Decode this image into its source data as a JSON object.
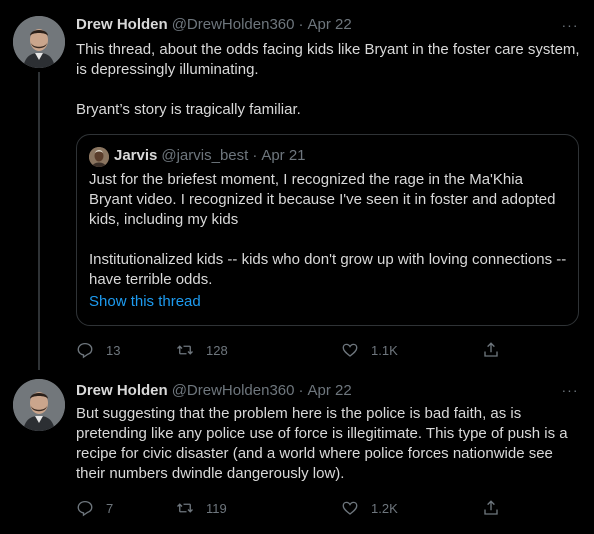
{
  "tweets": [
    {
      "author": {
        "display_name": "Drew Holden",
        "handle": "@DrewHolden360",
        "date": "Apr 22"
      },
      "more_label": "···",
      "text": [
        "This thread, about the odds facing kids like Bryant in the foster care system, is depressingly illuminating.",
        "Bryant’s story is tragically familiar."
      ],
      "quote": {
        "author": {
          "display_name": "Jarvis",
          "handle": "@jarvis_best",
          "date": "Apr 21"
        },
        "text": [
          "Just for the briefest moment, I recognized the rage in the Ma'Khia Bryant video. I recognized it because I've seen it in foster and adopted kids, including my kids",
          "Institutionalized kids -- kids who don't grow up with loving connections -- have terrible odds."
        ],
        "show_thread_label": "Show this thread"
      },
      "actions": {
        "replies": "13",
        "retweets": "128",
        "likes": "1.1K"
      }
    },
    {
      "author": {
        "display_name": "Drew Holden",
        "handle": "@DrewHolden360",
        "date": "Apr 22"
      },
      "more_label": "···",
      "text": [
        "But suggesting that the problem here is the police is bad faith, as is pretending like any police use of force is illegitimate. This type of push is a recipe for civic disaster (and a world where police forces nationwide see their numbers dwindle dangerously low)."
      ],
      "actions": {
        "replies": "7",
        "retweets": "119",
        "likes": "1.2K"
      }
    }
  ],
  "separator": "·",
  "icons": {
    "reply": "reply-icon",
    "retweet": "retweet-icon",
    "like": "heart-icon",
    "share": "share-icon",
    "more": "more-icon"
  },
  "colors": {
    "background": "#000000",
    "text": "#d9d9d9",
    "muted": "#6e767d",
    "link": "#1d9bf0",
    "border": "#2f3336"
  }
}
